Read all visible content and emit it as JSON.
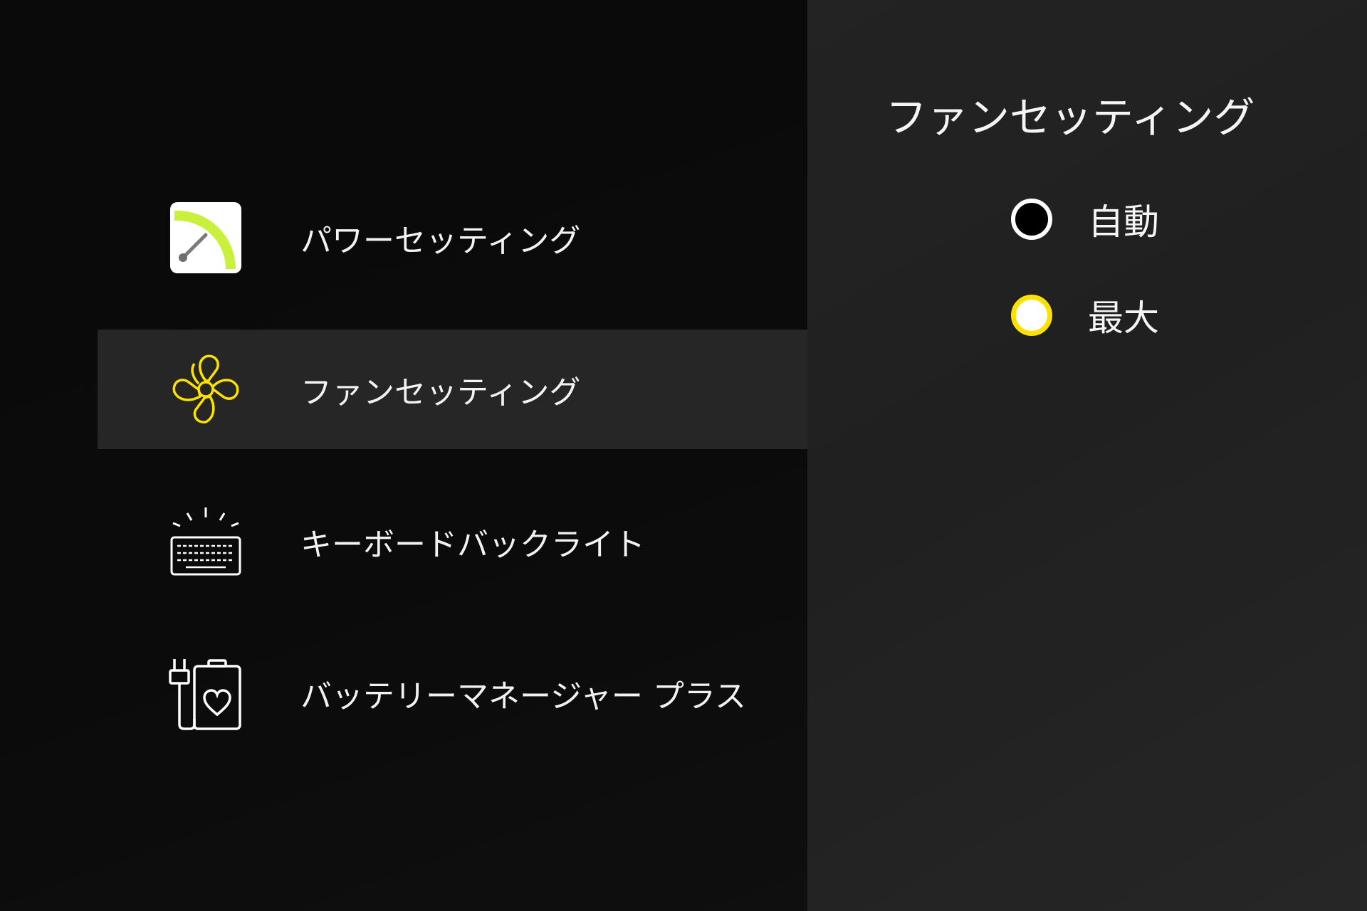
{
  "colors": {
    "accent": "#ffe100",
    "power_icon_accent": "#c8f03c",
    "selected_row_bg": "#262626"
  },
  "nav": {
    "items": [
      {
        "label": "パワーセッティング",
        "icon": "power-gauge-icon",
        "selected": false
      },
      {
        "label": "ファンセッティング",
        "icon": "fan-icon",
        "selected": true
      },
      {
        "label": "キーボードバックライト",
        "icon": "keyboard-backlight-icon",
        "selected": false
      },
      {
        "label": "バッテリーマネージャー プラス",
        "icon": "battery-manager-icon",
        "selected": false
      }
    ]
  },
  "detail": {
    "title": "ファンセッティング",
    "options": [
      {
        "label": "自動",
        "selected": false
      },
      {
        "label": "最大",
        "selected": true
      }
    ]
  }
}
